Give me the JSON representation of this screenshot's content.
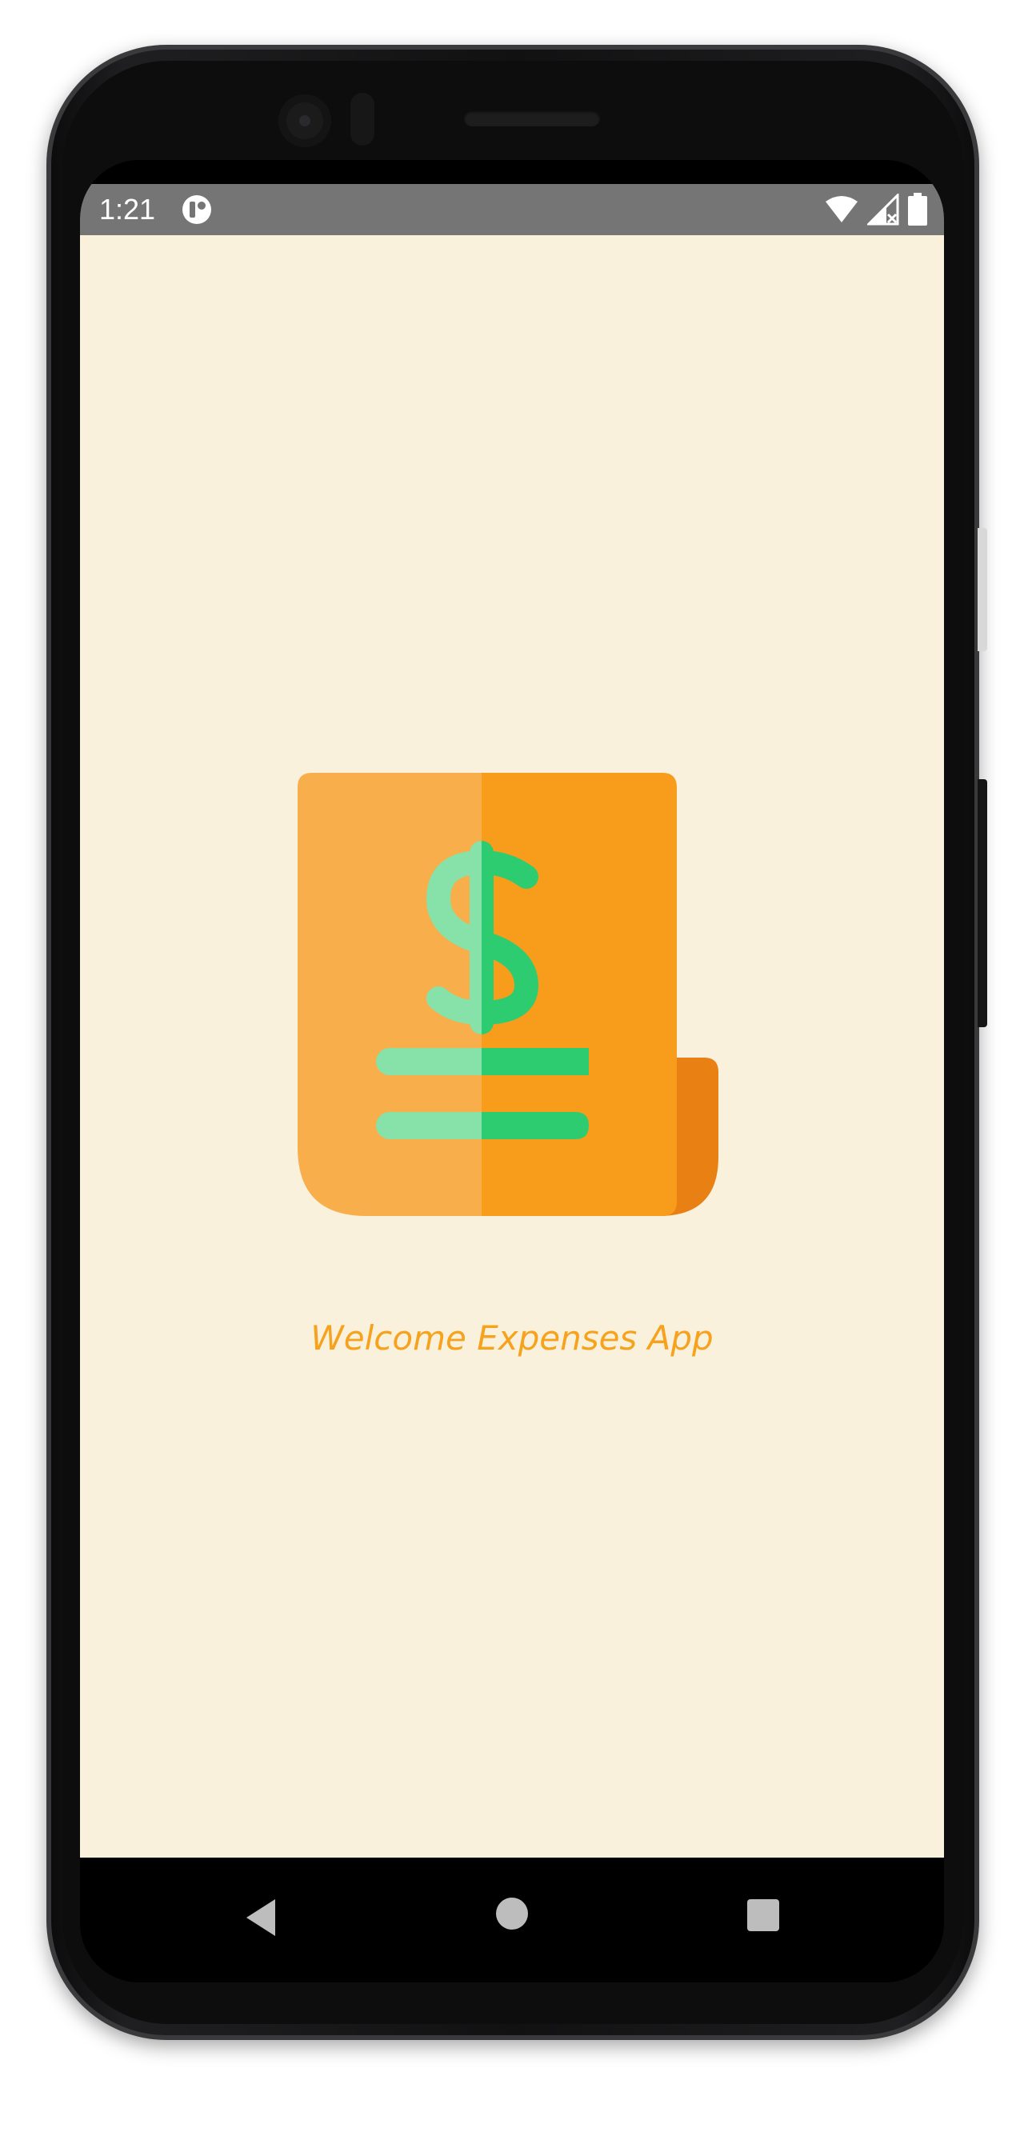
{
  "status_bar": {
    "time": "1:21",
    "app_icon": "app-notification-icon",
    "icons": [
      "wifi-icon",
      "signal-icon",
      "battery-icon"
    ]
  },
  "splash": {
    "logo_icon": "expense-receipt-dollar-icon",
    "welcome_text": "Welcome Expenses App"
  },
  "nav_bar": {
    "buttons": [
      "back-icon",
      "home-icon",
      "recents-icon"
    ]
  },
  "colors": {
    "background": "#f9f1dc",
    "accent_orange": "#f7a21d",
    "receipt_light": "#f8ae4a",
    "receipt_fold": "#e98013",
    "dollar_green": "#2ecc71",
    "dollar_green_light": "#86e2a8",
    "status_bar": "#757575"
  }
}
